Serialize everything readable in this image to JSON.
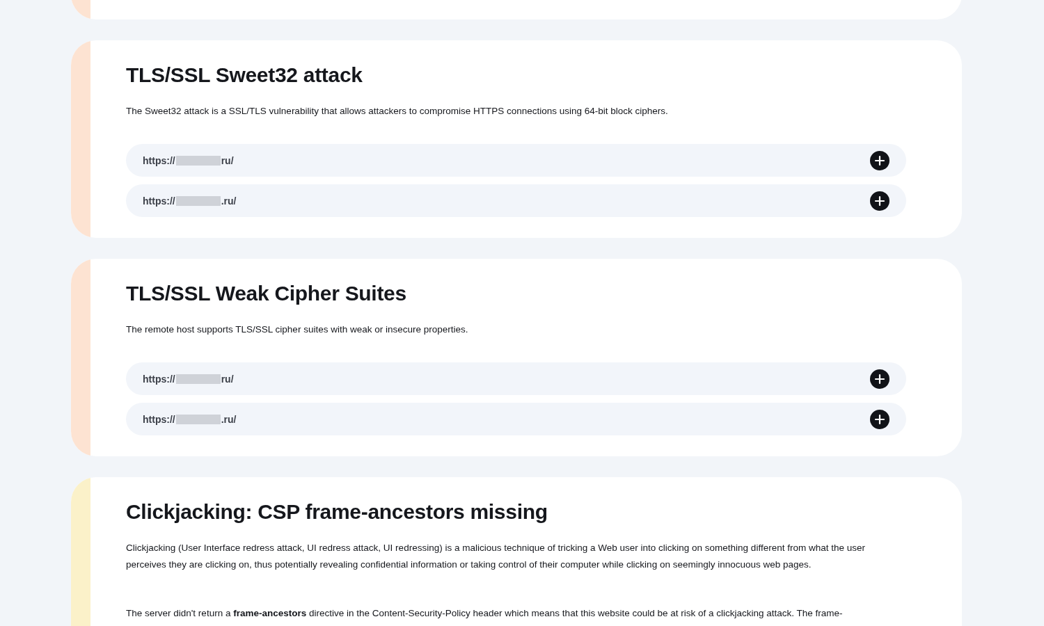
{
  "findings": [
    {
      "color": "#fde3d2"
    },
    {
      "color": "#fde3d2",
      "title": "TLS/SSL Sweet32 attack",
      "paragraphs": [
        "The Sweet32 attack is a SSL/TLS vulnerability that allows attackers to compromise HTTPS connections using 64-bit block ciphers."
      ],
      "urls": [
        {
          "prefix": "https://",
          "suffix": "ru/"
        },
        {
          "prefix": "https://",
          "suffix": ".ru/"
        }
      ]
    },
    {
      "color": "#fde3d2",
      "title": "TLS/SSL Weak Cipher Suites",
      "paragraphs": [
        "The remote host supports TLS/SSL cipher suites with weak or insecure properties."
      ],
      "urls": [
        {
          "prefix": "https://",
          "suffix": "ru/"
        },
        {
          "prefix": "https://",
          "suffix": ".ru/"
        }
      ]
    },
    {
      "color": "#fbf1c9",
      "title": "Clickjacking: CSP frame-ancestors missing",
      "paragraphs": [
        "Clickjacking (User Interface redress attack, UI redress attack, UI redressing) is a malicious technique of tricking a Web user into clicking on something different from what the user perceives they are clicking on, thus potentially revealing confidential information or taking control of their computer while clicking on seemingly innocuous web pages.",
        "The server didn't return a **frame-ancestors** directive in the Content-Security-Policy header which means that this website could be at risk of a clickjacking attack. The frame-"
      ]
    }
  ]
}
